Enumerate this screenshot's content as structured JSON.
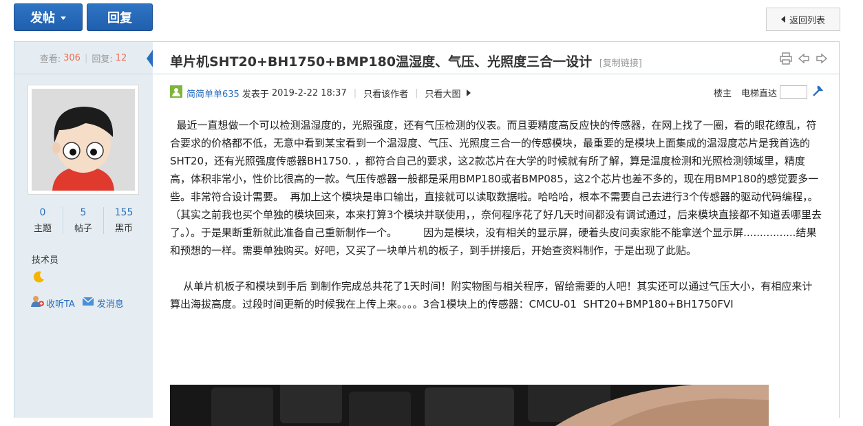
{
  "toolbar": {
    "post_label": "发帖",
    "reply_label": "回复",
    "back_label": "返回列表"
  },
  "stats": {
    "views_label": "查看:",
    "views": "306",
    "replies_label": "回复:",
    "replies": "12"
  },
  "user": {
    "counts": [
      {
        "value": "0",
        "label": "主题"
      },
      {
        "value": "5",
        "label": "帖子"
      },
      {
        "value": "155",
        "label": "黑币"
      }
    ],
    "role": "技术员",
    "follow_label": "收听TA",
    "message_label": "发消息"
  },
  "post": {
    "title": "单片机SHT20+BH1750+BMP180温湿度、气压、光照度三合一设计",
    "copy_link": "[复制链接]",
    "author": "简简单单635",
    "posted_prefix": "发表于",
    "posted_at": "2019-2-22 18:37",
    "only_author": "只看该作者",
    "only_large_images": "只看大图",
    "floor_label": "楼主",
    "jump_label": "电梯直达",
    "paragraph1": "  最近一直想做一个可以检测温湿度的，光照强度，还有气压检测的仪表。而且要精度高反应快的传感器，在网上找了一圈，看的眼花缭乱，符合要求的价格都不低，无意中看到某宝看到一个温湿度、气压、光照度三合一的传感模块，最重要的是模块上面集成的温湿度芯片是我首选的SHT20，还有光照强度传感器BH1750. ，都符合自己的要求，这2款芯片在大学的时候就有所了解，算是温度检测和光照检测领域里，精度高，体积非常小，性价比很高的一款。气压传感器一般都是采用BMP180或者BMP085，这2个芯片也差不多的，现在用BMP180的感觉要多一些。非常符合设计需要。  再加上这个模块是串口输出，直接就可以读取数据啦。哈哈哈，根本不需要自己去进行3个传感器的驱动代码编程，。（其实之前我也买个单独的模块回来，本来打算3个模块并联使用，，奈何程序花了好几天时间都没有调试通过，后来模块直接都不知道丢哪里去了。）。于是果断重新就此准备自己重新制作一个。        因为是模块，没有相关的显示屏，硬着头皮问卖家能不能拿送个显示屏................结果和预想的一样。需要单独购买。好吧，又买了一块单片机的板子，到手拼接后，开始查资料制作，于是出现了此贴。",
    "paragraph2": "    从单片机板子和模块到手后 到制作完成总共花了1天时间！附实物图与相关程序，留给需要的人吧！其实还可以通过气压大小，有相应来计算出海拔高度。过段时间更新的时候我在上传上来。。。。3合1模块上的传感器：CMCU-01  SHT20+BMP180+BH1750FVI"
  }
}
